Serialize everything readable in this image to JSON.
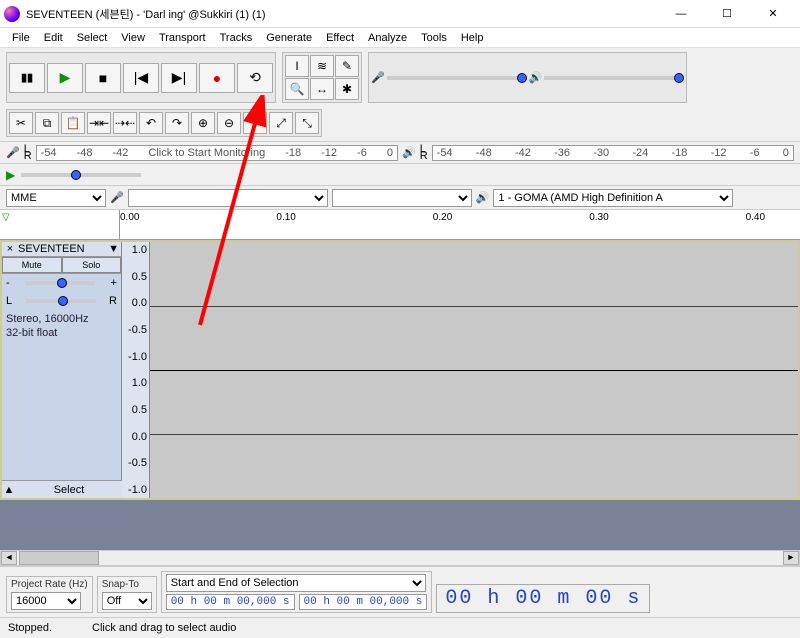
{
  "title": "SEVENTEEN (세븐틴) - 'Darl ing' @Sukkiri (1) (1)",
  "menu": [
    "File",
    "Edit",
    "Select",
    "View",
    "Transport",
    "Tracks",
    "Generate",
    "Effect",
    "Analyze",
    "Tools",
    "Help"
  ],
  "transport_icons": [
    "pause",
    "play",
    "stop",
    "skip-start",
    "skip-end",
    "record",
    "loop"
  ],
  "tool_icons": [
    "selection",
    "envelope",
    "draw",
    "zoom",
    "timeshift",
    "multi"
  ],
  "edit_icons": [
    "cut",
    "copy",
    "paste",
    "trim",
    "silence",
    "undo",
    "redo",
    "zoom-in",
    "zoom-out",
    "zoom-sel",
    "zoom-fit",
    "zoom-toggle"
  ],
  "rec_meter": {
    "label_left": "L",
    "label_right": "R",
    "ticks": [
      "-54",
      "-48",
      "-42",
      "Click to Start Monitoring",
      "-18",
      "-12",
      "-6",
      "0"
    ]
  },
  "play_meter": {
    "label_left": "L",
    "label_right": "R",
    "ticks": [
      "-54",
      "-48",
      "-42",
      "-36",
      "-30",
      "-24",
      "-18",
      "-12",
      "-6",
      "0"
    ]
  },
  "host": "MME",
  "out_device": "1 - GOMA (AMD High Definition A",
  "ruler": [
    "0.00",
    "0.10",
    "0.20",
    "0.30",
    "0.40"
  ],
  "track": {
    "name": "SEVENTEEN",
    "mute": "Mute",
    "solo": "Solo",
    "gain_minus": "-",
    "gain_plus": "+",
    "pan_l": "L",
    "pan_r": "R",
    "info1": "Stereo, 16000Hz",
    "info2": "32-bit float",
    "select": "Select",
    "scale": [
      "1.0",
      "0.5",
      "0.0",
      "-0.5",
      "-1.0",
      "1.0",
      "0.5",
      "0.0",
      "-0.5",
      "-1.0"
    ]
  },
  "bottom": {
    "rate_label": "Project Rate (Hz)",
    "rate_value": "16000",
    "snap_label": "Snap-To",
    "snap_value": "Off",
    "sel_label": "Start and End of Selection",
    "sel_start": "00 h 00 m 00,000 s",
    "sel_end": "00 h 00 m 00,000 s",
    "bigtime": "00 h 00 m 00 s"
  },
  "status": {
    "left": "Stopped.",
    "right": "Click and drag to select audio"
  }
}
